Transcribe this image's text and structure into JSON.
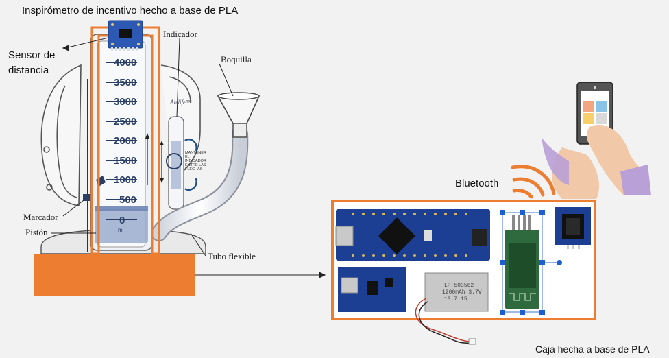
{
  "title": "Inspirómetro de incentivo hecho a base de PLA",
  "labels": {
    "sensor": "Sensor de distancia",
    "sensor_line1": "Sensor de",
    "sensor_line2": "distancia",
    "indicador": "Indicador",
    "boquilla": "Boquilla",
    "marcador": "Marcador",
    "piston": "Pistón",
    "tubo": "Tubo flexible",
    "bluetooth": "Bluetooth",
    "caja": "Caja hecha a base de PLA",
    "brand": "Airlife™",
    "mantener": [
      "MANTENER",
      "EL",
      "INDICADOR",
      "ENTRE LAS",
      "FLECHAS"
    ],
    "ml": "ml",
    "battery": [
      "LP-503562",
      "1200mAh 3.7V",
      "13.7.15"
    ]
  },
  "scale": [
    "4000",
    "3500",
    "3000",
    "2500",
    "2000",
    "1500",
    "1000",
    "500",
    "0"
  ],
  "colors": {
    "orange": "#ed7d31",
    "board_blue": "#1c3f94",
    "phone_screen": "#ffffff",
    "sleeve": "#b9a0d6"
  },
  "icons": [
    "wifi-signal-icon",
    "phone-hand-icon",
    "arrow-icon"
  ]
}
